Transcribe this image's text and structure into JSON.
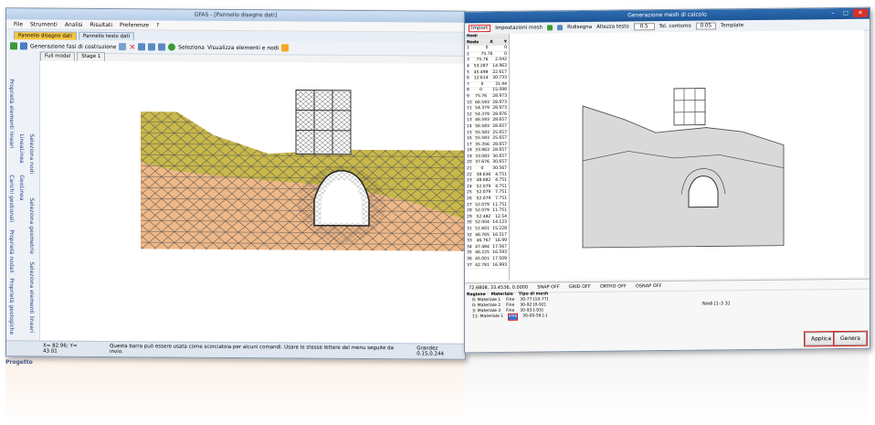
{
  "left_window": {
    "title": "GFAS - [Pannello disegno dati]",
    "menu": [
      "File",
      "Strumenti",
      "Analisi",
      "Risultati",
      "Preferenze",
      "?"
    ],
    "tabs": [
      "Pannello disegno dati",
      "Pannello testo dati"
    ],
    "toolbar_label": "Generazione fasi di costruzione",
    "toolbar_text_1": "Seleziona",
    "toolbar_text_2": "Visualizza elementi e nodi",
    "canvas_tabs": [
      "Full model",
      "Stage 1"
    ],
    "side_labels": [
      "Proprietà elementi lineari",
      "Carichi gestionali",
      "Proprietà nodali",
      "Proprietà geologiche",
      "LineaLinea",
      "GeoLinea",
      "Seleziona nodi",
      "Seleziona geometrie",
      "Seleziona elementi lineari"
    ],
    "status_coords": "X= 82.96; Y= 43.01",
    "status_hint": "Questa barra può essere usata come scorciatoia per alcuni comandi. Usare le stesse lettere del menu seguite da invio.",
    "status_right": "Grandez 0.15,0.244",
    "panel_label": "Progetto"
  },
  "right_window": {
    "title": "Generazione mesh di calcolo",
    "toolbar": {
      "import": "Import",
      "settings": "Impostazioni mesh",
      "redraw": "Ridisegna",
      "text_height_label": "Altezza testo",
      "text_height_value": "0.5",
      "tolerance_label": "Tol. contorno",
      "tolerance_value": "0.05",
      "template": "Template"
    },
    "table_title": "Nodi",
    "table_headers": [
      "Nodo",
      "X",
      "Y"
    ],
    "table_rows": [
      [
        "1",
        "0",
        "0"
      ],
      [
        "2",
        "75.76",
        "0"
      ],
      [
        "3",
        "75.76",
        "2.042"
      ],
      [
        "4",
        "53.287",
        "14.963"
      ],
      [
        "5",
        "45.498",
        "22.617"
      ],
      [
        "6",
        "12.614",
        "30.733"
      ],
      [
        "7",
        "0",
        "31.44"
      ],
      [
        "8",
        "0",
        "15.098"
      ],
      [
        "9",
        "75.76",
        "28.973"
      ],
      [
        "10",
        "66.593",
        "28.973"
      ],
      [
        "11",
        "54.379",
        "28.973"
      ],
      [
        "12",
        "54.379",
        "28.976"
      ],
      [
        "13",
        "46.593",
        "28.657"
      ],
      [
        "14",
        "56.583",
        "28.657"
      ],
      [
        "15",
        "55.583",
        "25.657"
      ],
      [
        "16",
        "55.583",
        "25.657"
      ],
      [
        "17",
        "35.356",
        "28.657"
      ],
      [
        "18",
        "33.863",
        "28.657"
      ],
      [
        "19",
        "33.083",
        "30.657"
      ],
      [
        "20",
        "37.676",
        "30.657"
      ],
      [
        "21",
        "0",
        "30.567"
      ],
      [
        "22",
        "38.636",
        "4.751"
      ],
      [
        "23",
        "48.682",
        "4.751"
      ],
      [
        "24",
        "52.079",
        "4.751"
      ],
      [
        "25",
        "52.079",
        "7.751"
      ],
      [
        "26",
        "52.079",
        "7.751"
      ],
      [
        "27",
        "52.079",
        "11.751"
      ],
      [
        "28",
        "52.079",
        "11.751"
      ],
      [
        "29",
        "52.482",
        "12.54"
      ],
      [
        "30",
        "52.004",
        "14.123"
      ],
      [
        "31",
        "51.601",
        "15.228"
      ],
      [
        "32",
        "46.765",
        "16.517"
      ],
      [
        "33",
        "46.767",
        "16.99"
      ],
      [
        "34",
        "47.484",
        "17.567"
      ],
      [
        "35",
        "46.225",
        "16.593"
      ],
      [
        "36",
        "45.001",
        "17.509"
      ],
      [
        "37",
        "42.781",
        "16.993"
      ]
    ],
    "coord_readout": "72.6808, 33.4536, 0.0000",
    "snap_items": [
      "SNAP OFF",
      "GRID OFF",
      "ORTHO OFF",
      "OSNAP OFF"
    ],
    "mat_headers": [
      "Regione",
      "Materiale",
      "Tipo di mesh"
    ],
    "mat_rows": [
      [
        "",
        "0: Materiale 1",
        "Fine",
        "30-77 [10-77]"
      ],
      [
        "",
        "0: Materiale 2",
        "Fine",
        "30-92 [0-92]"
      ],
      [
        "",
        "3: Materiale 3",
        "Fine",
        "30-93 [-93]"
      ],
      [
        "",
        "11: Materiale 1",
        "Fine",
        "30-00-56 [-]"
      ]
    ],
    "nodes_label": "Nodi [1-3 3]",
    "apply_label": "Applica",
    "generate_label": "Genera"
  },
  "colors": {
    "soil_top": "#c9b84a",
    "soil_bottom": "#efb888",
    "tunnel": "#ffffff",
    "mesh_grey": "#d9d9d9",
    "highlight": "#d22222",
    "active_tab": "#f5c542"
  },
  "icons": [
    "save-icon",
    "delete-icon",
    "zoom-icon",
    "select-icon",
    "grid-icon",
    "tunnel-icon"
  ]
}
